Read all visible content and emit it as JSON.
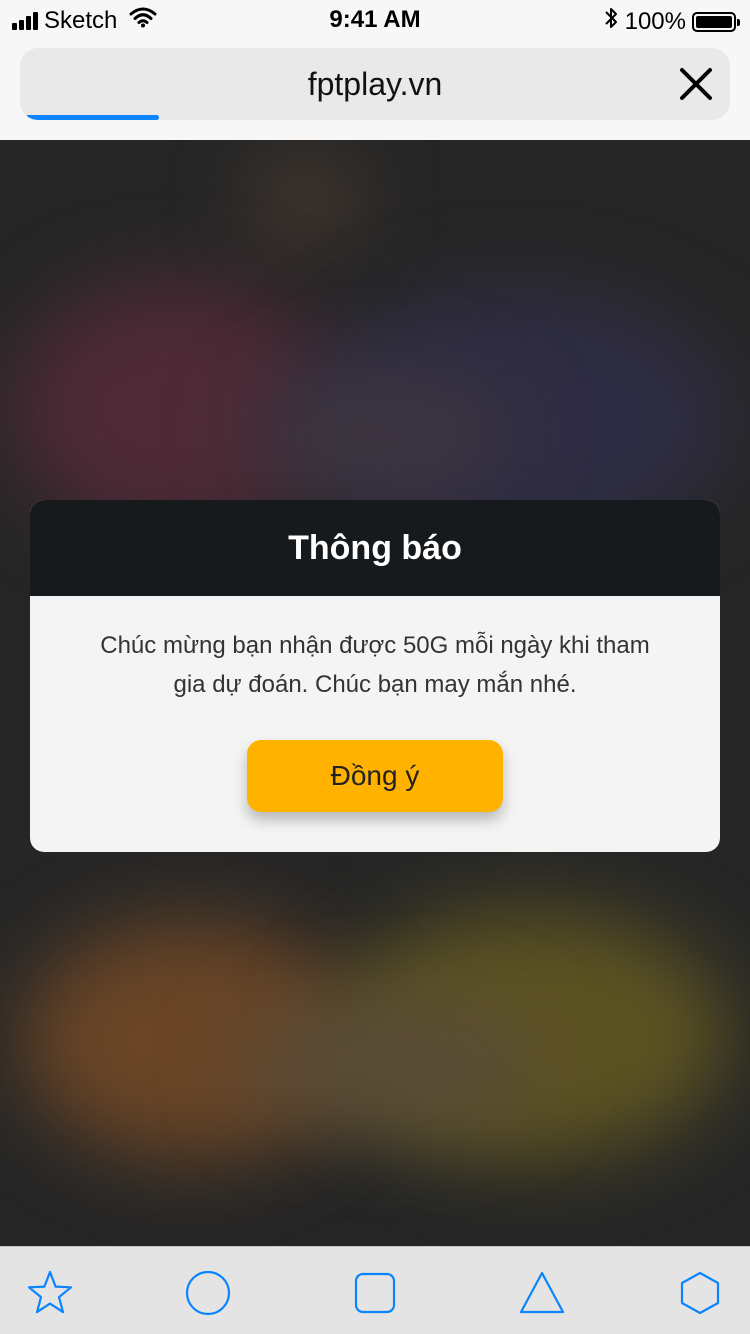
{
  "status_bar": {
    "carrier": "Sketch",
    "time": "9:41 AM",
    "battery_text": "100%",
    "battery_level": 1.0
  },
  "browser": {
    "url": "fptplay.vn",
    "load_progress": 0.19,
    "accent_color": "#0a84ff"
  },
  "dialog": {
    "title": "Thông báo",
    "message": "Chúc mừng bạn nhận được 50G mỗi ngày khi tham gia dự đoán. Chúc bạn may mắn nhé.",
    "confirm_label": "Đồng ý",
    "button_color": "#ffb300",
    "header_color": "#171a1d"
  },
  "toolbar": {
    "items": [
      {
        "icon": "star-icon"
      },
      {
        "icon": "circle-icon"
      },
      {
        "icon": "square-icon"
      },
      {
        "icon": "triangle-icon"
      },
      {
        "icon": "hexagon-icon"
      }
    ],
    "icon_color": "#0a84ff"
  }
}
